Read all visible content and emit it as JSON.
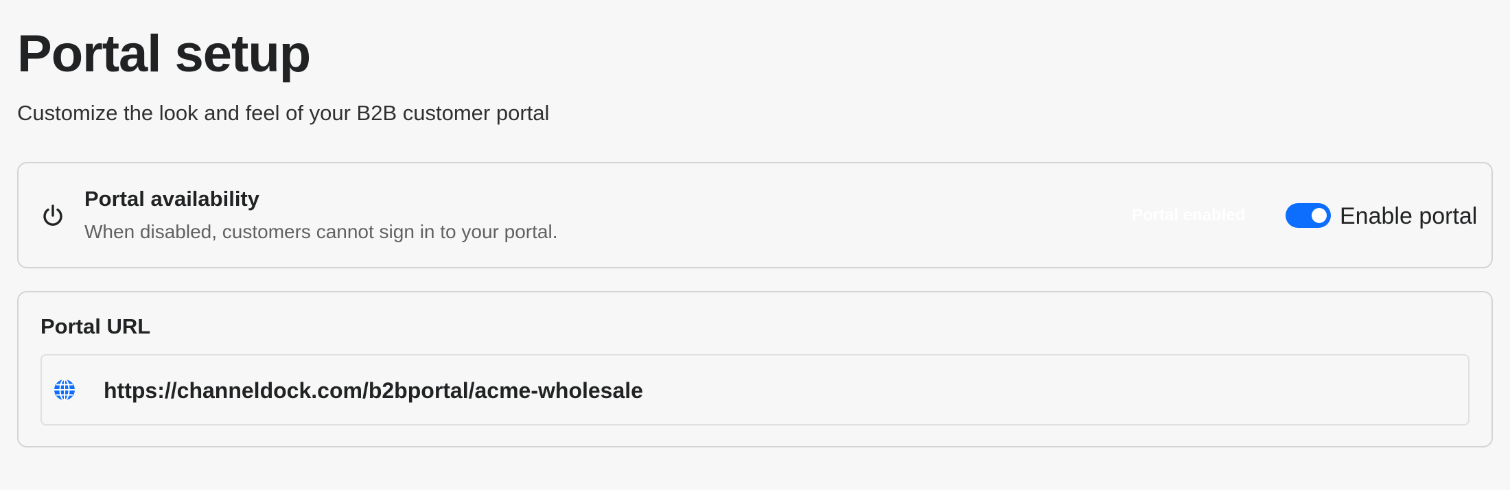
{
  "header": {
    "title": "Portal setup",
    "subtitle": "Customize the look and feel of your B2B customer portal"
  },
  "availability": {
    "icon": "power-icon",
    "title": "Portal availability",
    "description": "When disabled, customers cannot sign in to your portal.",
    "status_label": "Portal enabled",
    "toggle_label": "Enable portal",
    "toggle_on": true
  },
  "portal_url": {
    "title": "Portal URL",
    "icon": "globe-icon",
    "value": "https://channeldock.com/b2bportal/acme-wholesale"
  },
  "colors": {
    "accent": "#0d6efd",
    "background": "#f7f7f7",
    "border": "#d4d4d4",
    "muted_text": "#616161"
  }
}
